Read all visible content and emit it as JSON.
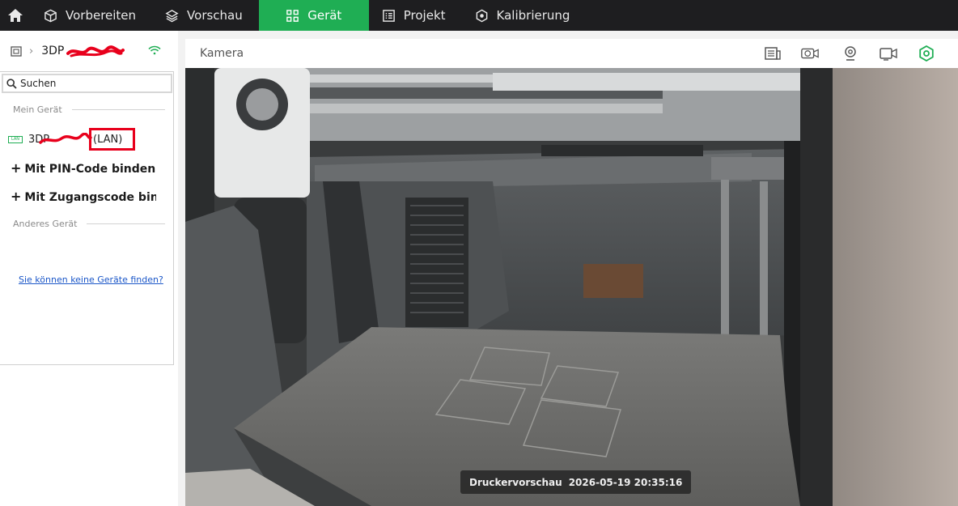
{
  "nav": {
    "tabs": [
      {
        "label": "Vorbereiten",
        "icon": "cube-icon"
      },
      {
        "label": "Vorschau",
        "icon": "layers-icon"
      },
      {
        "label": "Gerät",
        "icon": "device-icon",
        "active": true
      },
      {
        "label": "Projekt",
        "icon": "list-icon"
      },
      {
        "label": "Kalibrierung",
        "icon": "calibration-icon"
      }
    ],
    "active_color": "#1fae54"
  },
  "sidebar": {
    "current_device": "3DP",
    "search_placeholder": "Suchen",
    "my_devices_header": "Mein Gerät",
    "device_item": {
      "name": "3DP",
      "connection": "(LAN)",
      "badge": "LAN"
    },
    "bind_pin": "Mit PIN-Code binden",
    "bind_access": "Mit Zugangscode binden",
    "other_devices_header": "Anderes Gerät",
    "help_link": "Sie können keine Geräte finden?"
  },
  "camera": {
    "title": "Kamera",
    "overlay_label": "Druckervorschau",
    "overlay_timestamp": "2026-05-19 20:35:16"
  },
  "colors": {
    "annotation_red": "#e8001c",
    "link_blue": "#1a56c8"
  }
}
